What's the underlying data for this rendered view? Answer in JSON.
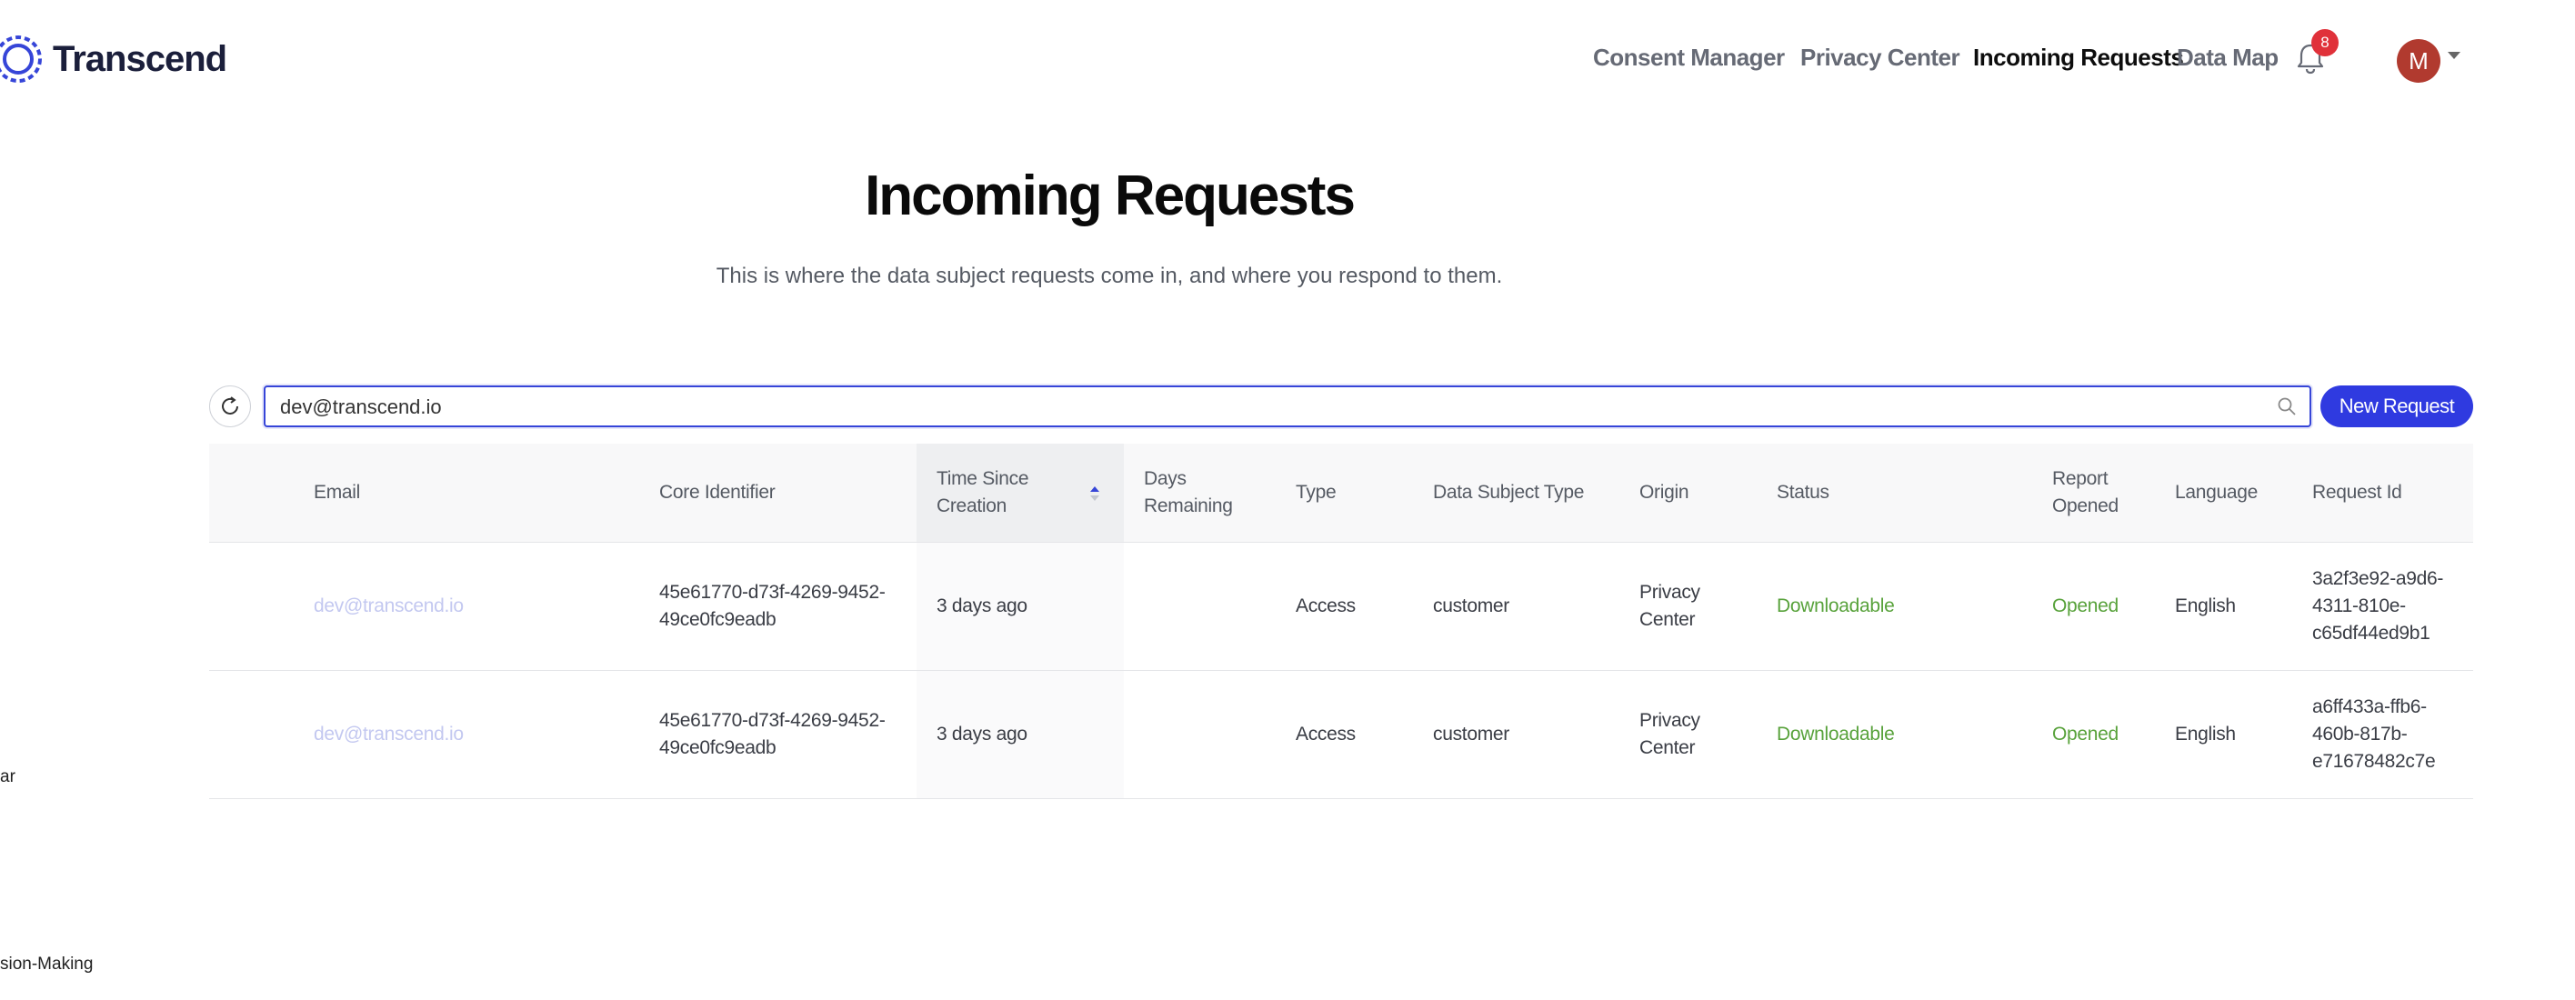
{
  "brand": {
    "name": "Transcend",
    "accent": "#3645d8"
  },
  "nav": {
    "items": [
      {
        "label": "Consent Manager",
        "active": false
      },
      {
        "label": "Privacy Center",
        "active": false
      },
      {
        "label": "Incoming Requests",
        "active": true
      },
      {
        "label": "Data Map",
        "active": false
      }
    ],
    "notification_count": "8",
    "avatar_initial": "M"
  },
  "page": {
    "title": "Incoming Requests",
    "subtitle": "This is where the data subject requests come in, and where you respond to them."
  },
  "search": {
    "value": "dev@transcend.io"
  },
  "toolbar": {
    "new_request_label": "New Request"
  },
  "table": {
    "columns": {
      "email": "Email",
      "core_identifier": "Core Identifier",
      "time_since_creation_1": "Time Since",
      "time_since_creation_2": "Creation",
      "days_remaining_1": "Days",
      "days_remaining_2": "Remaining",
      "type": "Type",
      "data_subject_type": "Data Subject Type",
      "origin": "Origin",
      "status": "Status",
      "report_opened_1": "Report",
      "report_opened_2": "Opened",
      "language": "Language",
      "request_id": "Request Id"
    },
    "rows": [
      {
        "email": "dev@transcend.io",
        "core_1": "45e61770-d73f-4269-9452-",
        "core_2": "49ce0fc9eadb",
        "time": "3 days ago",
        "days": "",
        "type": "Access",
        "subject": "customer",
        "origin_1": "Privacy",
        "origin_2": "Center",
        "status": "Downloadable",
        "report": "Opened",
        "language": "English",
        "req_1": "3a2f3e92-a9d6-",
        "req_2": "4311-810e-",
        "req_3": "c65df44ed9b1"
      },
      {
        "email": "dev@transcend.io",
        "core_1": "45e61770-d73f-4269-9452-",
        "core_2": "49ce0fc9eadb",
        "time": "3 days ago",
        "days": "",
        "type": "Access",
        "subject": "customer",
        "origin_1": "Privacy",
        "origin_2": "Center",
        "status": "Downloadable",
        "report": "Opened",
        "language": "English",
        "req_1": "a6ff433a-ffb6-",
        "req_2": "460b-817b-",
        "req_3": "e71678482c7e"
      }
    ]
  },
  "fragments": {
    "frag_1": "ar",
    "frag_2": "sion-Making"
  }
}
